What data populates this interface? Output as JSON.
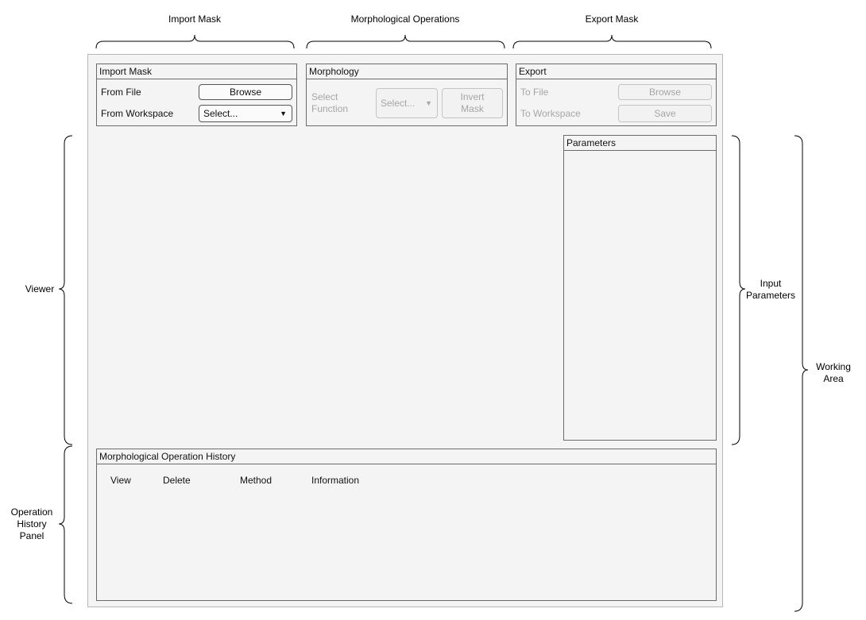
{
  "annotations": {
    "import_mask": "Import Mask",
    "morphological_operations": "Morphological Operations",
    "export_mask": "Export Mask",
    "viewer": "Viewer",
    "input_parameters_line1": "Input",
    "input_parameters_line2": "Parameters",
    "working_area_line1": "Working",
    "working_area_line2": "Area",
    "history_line1": "Operation",
    "history_line2": "History",
    "history_line3": "Panel"
  },
  "import_panel": {
    "title": "Import Mask",
    "from_file_label": "From File",
    "browse_label": "Browse",
    "from_workspace_label": "From Workspace",
    "workspace_select_value": "Select..."
  },
  "morphology_panel": {
    "title": "Morphology",
    "select_function_line1": "Select",
    "select_function_line2": "Function",
    "function_select_value": "Select...",
    "invert_line1": "Invert",
    "invert_line2": "Mask"
  },
  "export_panel": {
    "title": "Export",
    "to_file_label": "To File",
    "browse_label": "Browse",
    "to_workspace_label": "To Workspace",
    "save_label": "Save"
  },
  "parameters_panel": {
    "title": "Parameters"
  },
  "history_panel": {
    "title": "Morphological Operation History",
    "columns": [
      "View",
      "Delete",
      "Method",
      "Information"
    ]
  },
  "icons": {
    "dropdown": "chevron-down-icon"
  }
}
